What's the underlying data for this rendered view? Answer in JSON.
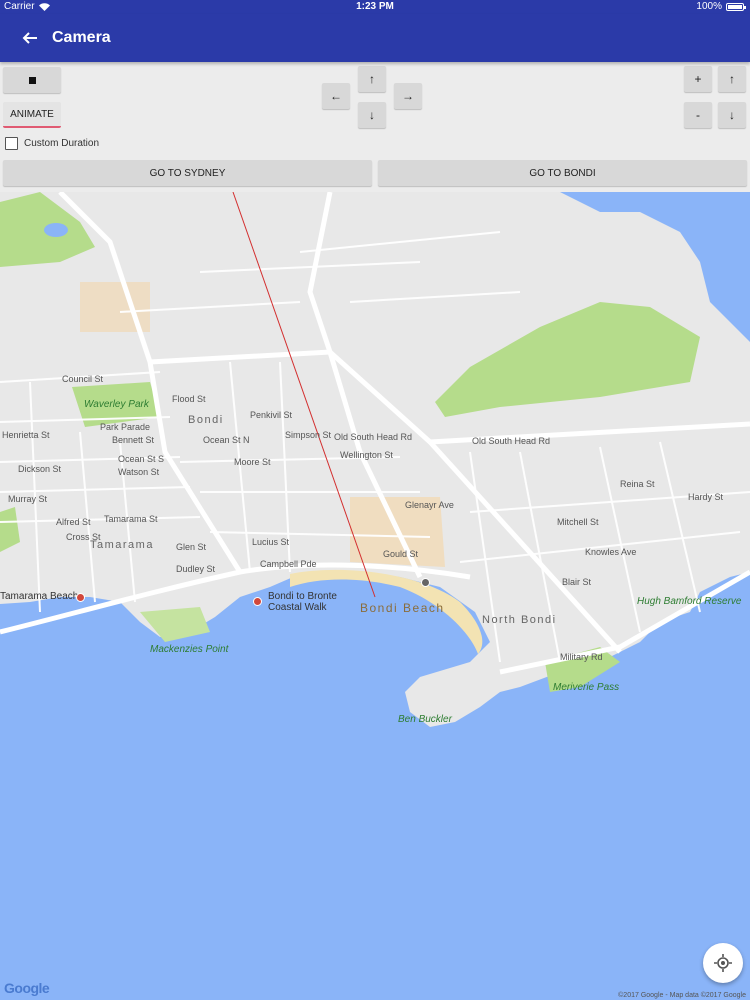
{
  "status_bar": {
    "carrier": "Carrier",
    "time": "1:23 PM",
    "battery": "100%"
  },
  "app_bar": {
    "title": "Camera",
    "back_icon": "arrow-back-icon"
  },
  "controls": {
    "stop_icon": "stop-square-icon",
    "animate_label": "ANIMATE",
    "up": "↑",
    "left": "←",
    "right": "→",
    "down": "↓",
    "zoom_in": "+",
    "zoom_out": "-",
    "tilt_up": "↑",
    "tilt_down": "↓",
    "custom_duration_label": "Custom Duration",
    "custom_duration_checked": false,
    "go_sydney": "GO TO SYDNEY",
    "go_bondi": "GO TO BONDI"
  },
  "map": {
    "suburbs": [
      "Bondi",
      "Tamarama",
      "North Bondi"
    ],
    "streets": [
      "Council St",
      "Flood St",
      "Penkivil St",
      "Ocean St N",
      "Simpson St",
      "Old South Head Rd",
      "Wellington St",
      "Moore St",
      "Watson St",
      "Dickson St",
      "Murray St",
      "Alfred St",
      "Tamarama St",
      "Cross St",
      "Glen St",
      "Dudley St",
      "Lucius St",
      "Glenayr Ave",
      "Gould St",
      "Mitchell St",
      "Knowles Ave",
      "Military Rd",
      "Reina St",
      "Hardy St",
      "Blair St",
      "Campbell Pde",
      "Bennett St",
      "Ocean St S",
      "Park Parade",
      "Henrietta St",
      "Old South Head Rd"
    ],
    "parks": [
      "Waverley Park",
      "Mackenzies Point",
      "Hugh Bamford Reserve",
      "Meriverie Pass",
      "Ben Buckler"
    ],
    "pois": [
      "Tamarama Beach",
      "Bondi to Bronte Coastal Walk"
    ],
    "beach": "Bondi Beach",
    "logo": "Google",
    "attribution": "©2017 Google - Map data ©2017 Google",
    "location_icon": "my-location-icon"
  },
  "colors": {
    "app_bar": "#2b3aa8",
    "water": "#8ab4f8",
    "land": "#e8e8e8",
    "park": "#b5dc8b",
    "accent": "#e05a72"
  }
}
